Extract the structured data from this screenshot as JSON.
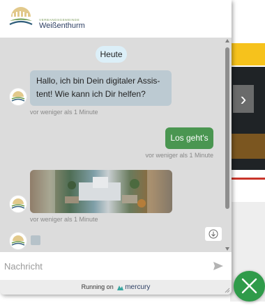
{
  "header": {
    "logo_subtitle": "VERBANDSGEMEINDE",
    "logo_name": "Weißenthurm"
  },
  "conversation": {
    "date_label": "Heute",
    "bot_message": {
      "line1": "Hallo, ich bin Dein digitaler Assis-",
      "line2": "tent! Wie kann ich Dir helfen?",
      "time": "vor weniger als 1 Minute"
    },
    "user_message": {
      "text": "Los geht's",
      "time": "vor weniger als 1 Minute"
    },
    "image_message": {
      "time": "vor weniger als 1 Minute"
    }
  },
  "input": {
    "placeholder": "Nachricht"
  },
  "footer": {
    "running_on": "Running on",
    "brand": "mercury"
  },
  "colors": {
    "accent_green": "#4a9651",
    "fab_green": "#2f9b4a",
    "bot_bubble": "#bccad2",
    "date_pill": "#dceff8",
    "chat_background": "#dcdcdc"
  },
  "icons": {
    "send": "send-icon",
    "close": "close-icon",
    "scroll_down": "arrow-down-circle-icon",
    "slider_next": "chevron-right-icon"
  }
}
